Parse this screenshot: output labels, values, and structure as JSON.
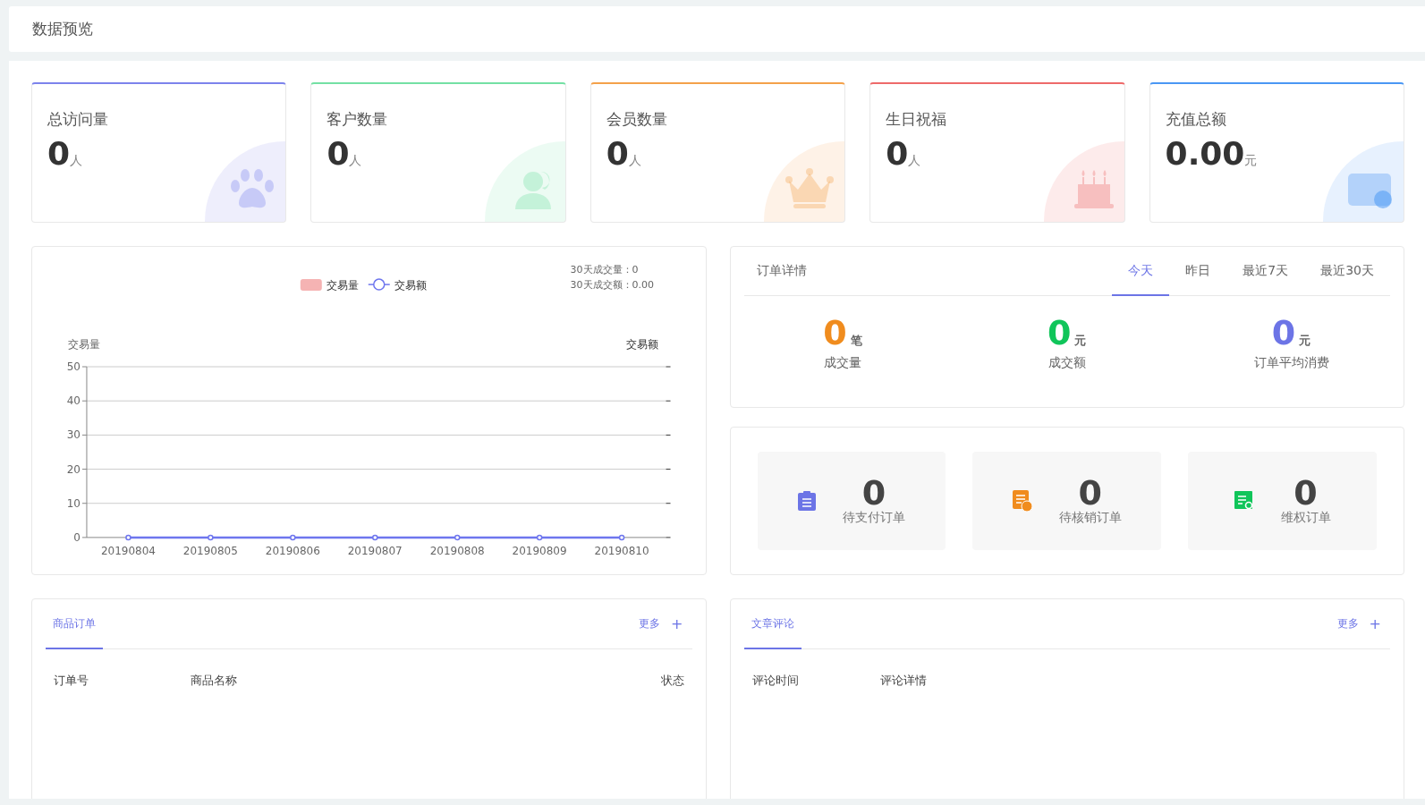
{
  "header": {
    "title": "数据预览"
  },
  "stat_cards": [
    {
      "title": "总访问量",
      "value": "0",
      "unit": "人",
      "color": "#7c83ec"
    },
    {
      "title": "客户数量",
      "value": "0",
      "unit": "人",
      "color": "#74e0a4"
    },
    {
      "title": "会员数量",
      "value": "0",
      "unit": "人",
      "color": "#f4a14a"
    },
    {
      "title": "生日祝福",
      "value": "0",
      "unit": "人",
      "color": "#ee6a6a"
    },
    {
      "title": "充值总额",
      "value": "0.00",
      "unit": "元",
      "color": "#4a97f4"
    }
  ],
  "trade_chart": {
    "summary": [
      "30天成交量：0",
      "30天成交额：0.00"
    ],
    "right_axis_label": "交易额",
    "chart_data": {
      "type": "line",
      "ylabel": "交易量",
      "categories": [
        "20190804",
        "20190805",
        "20190806",
        "20190807",
        "20190808",
        "20190809",
        "20190810"
      ],
      "series": [
        {
          "name": "交易量",
          "color": "#f5b3b3",
          "values": [
            null,
            null,
            null,
            null,
            null,
            null,
            null
          ]
        },
        {
          "name": "交易额",
          "color": "#6e76ee",
          "marker": "circle",
          "values": [
            0,
            0,
            0,
            0,
            0,
            0,
            0
          ]
        }
      ],
      "ylim": [
        0,
        50
      ],
      "yticks": [
        0,
        10,
        20,
        30,
        40,
        50
      ],
      "grid": true,
      "legend": "top"
    }
  },
  "order_detail": {
    "title": "订单详情",
    "tabs": [
      {
        "label": "今天",
        "selected": true
      },
      {
        "label": "昨日",
        "selected": false
      },
      {
        "label": "最近7天",
        "selected": false
      },
      {
        "label": "最近30天",
        "selected": false
      }
    ],
    "metrics": [
      {
        "value": "0",
        "unit": "笔",
        "label": "成交量",
        "color": "#f08c1e"
      },
      {
        "value": "0",
        "unit": "元",
        "label": "成交额",
        "color": "#10c55a"
      },
      {
        "value": "0",
        "unit": "元",
        "label": "订单平均消费",
        "color": "#6c74e6"
      }
    ]
  },
  "pending_orders": [
    {
      "value": "0",
      "label": "待支付订单",
      "color": "#6c74e6"
    },
    {
      "value": "0",
      "label": "待核销订单",
      "color": "#f08c1e"
    },
    {
      "value": "0",
      "label": "维权订单",
      "color": "#10c55a"
    }
  ],
  "lists": [
    {
      "tab": {
        "label": "商品订单",
        "selected": true
      },
      "more": "更多",
      "plus": "+",
      "columns": [
        "订单号",
        "商品名称",
        "状态"
      ]
    },
    {
      "tab": {
        "label": "文章评论",
        "selected": true
      },
      "more": "更多",
      "plus": "+",
      "columns": [
        "评论时间",
        "评论详情"
      ]
    }
  ]
}
